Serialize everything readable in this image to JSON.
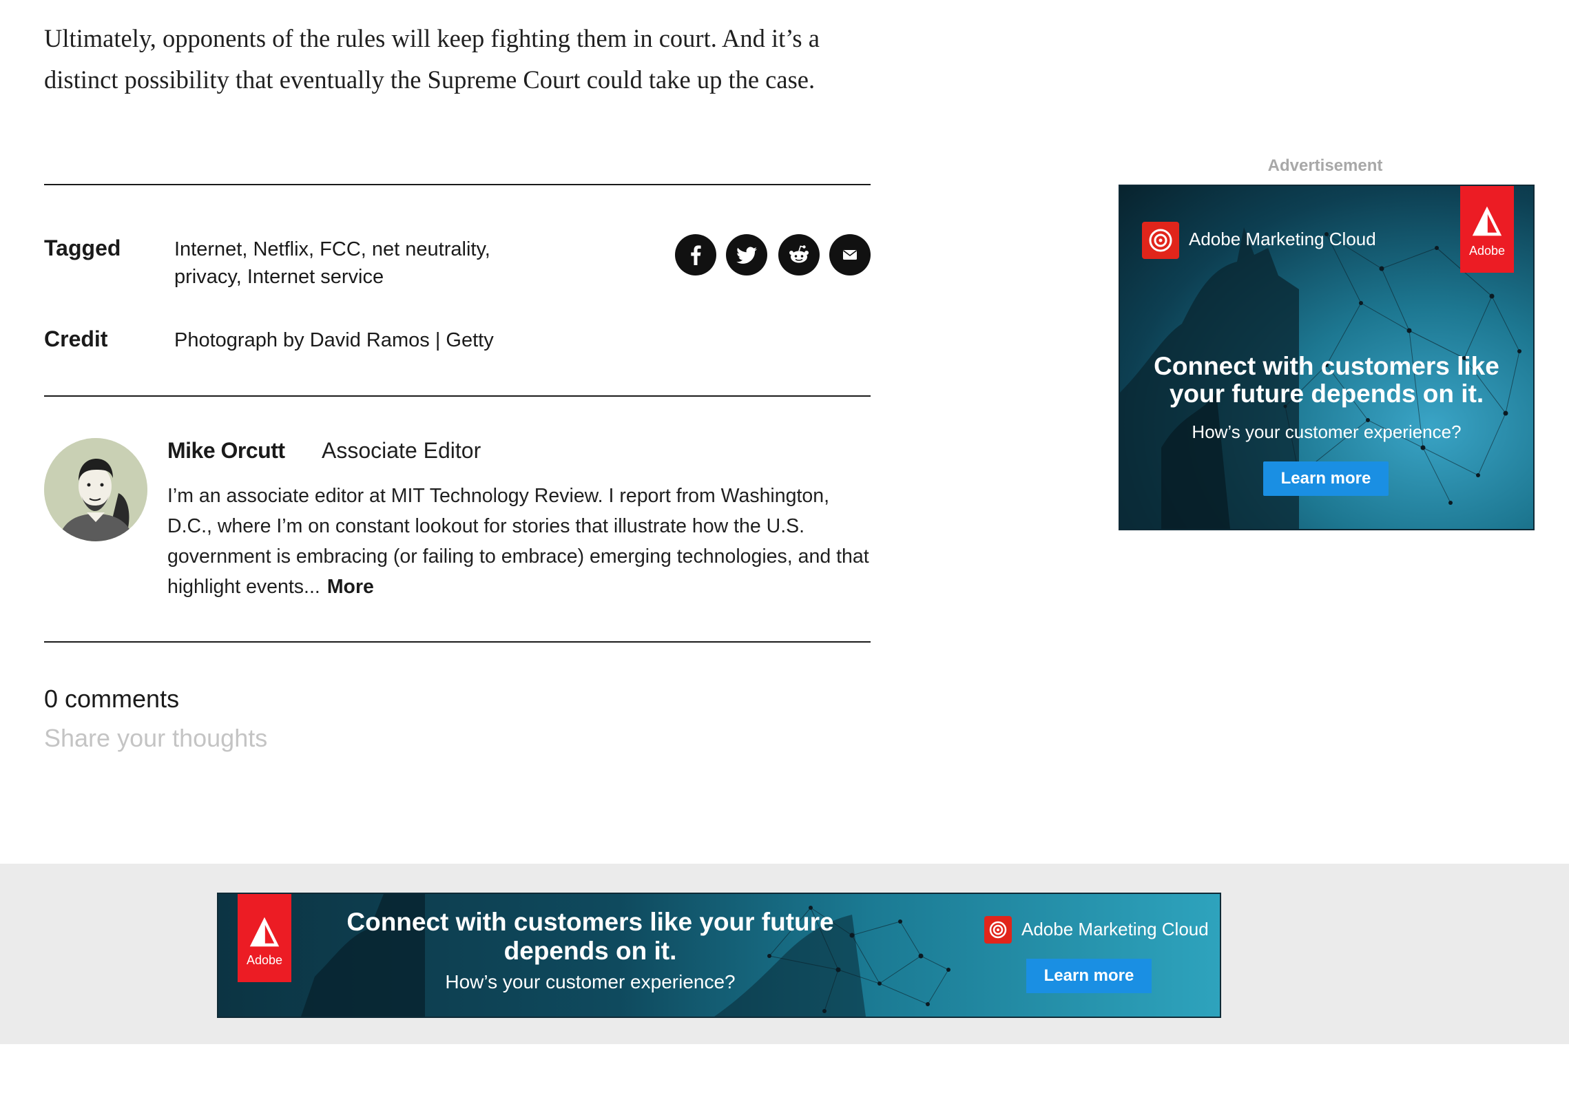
{
  "article": {
    "closing_paragraph": "Ultimately, opponents of the rules will keep fighting them in court. And it’s a distinct possibility that eventually the Supreme Court could take up the case."
  },
  "meta": {
    "tagged_label": "Tagged",
    "tags": [
      "Internet",
      "Netflix",
      "FCC",
      "net neutrality",
      "privacy",
      "Internet service"
    ],
    "credit_label": "Credit",
    "credit_value": "Photograph by David Ramos | Getty"
  },
  "share": {
    "icons": [
      "facebook-icon",
      "twitter-icon",
      "reddit-icon",
      "email-icon"
    ]
  },
  "author": {
    "name": "Mike Orcutt",
    "role": "Associate Editor",
    "bio": "I’m an associate editor at MIT Technology Review. I report from Washington, D.C., where I’m on constant lookout for stories that illustrate how the U.S. government is embracing (or failing to embrace) emerging technologies, and that highlight events...",
    "more_label": "More"
  },
  "comments": {
    "count_label": "0 comments",
    "placeholder": "Share your thoughts"
  },
  "side_ad": {
    "label": "Advertisement",
    "brand": "Adobe Marketing Cloud",
    "logo_word": "Adobe",
    "headline": "Connect with customers like your future depends on it.",
    "subline": "How’s your customer experience?",
    "cta": "Learn more"
  },
  "banner_ad": {
    "logo_word": "Adobe",
    "headline": "Connect with customers like your future depends on it.",
    "subline": "How’s your customer experience?",
    "brand": "Adobe Marketing Cloud",
    "cta": "Learn more"
  },
  "colors": {
    "adobe_red": "#ec1c24",
    "cta_blue": "#1a8fe3",
    "ad_label_gray": "#a8a8a8",
    "placeholder_gray": "#c4c4c4",
    "band_gray": "#ebebeb"
  }
}
